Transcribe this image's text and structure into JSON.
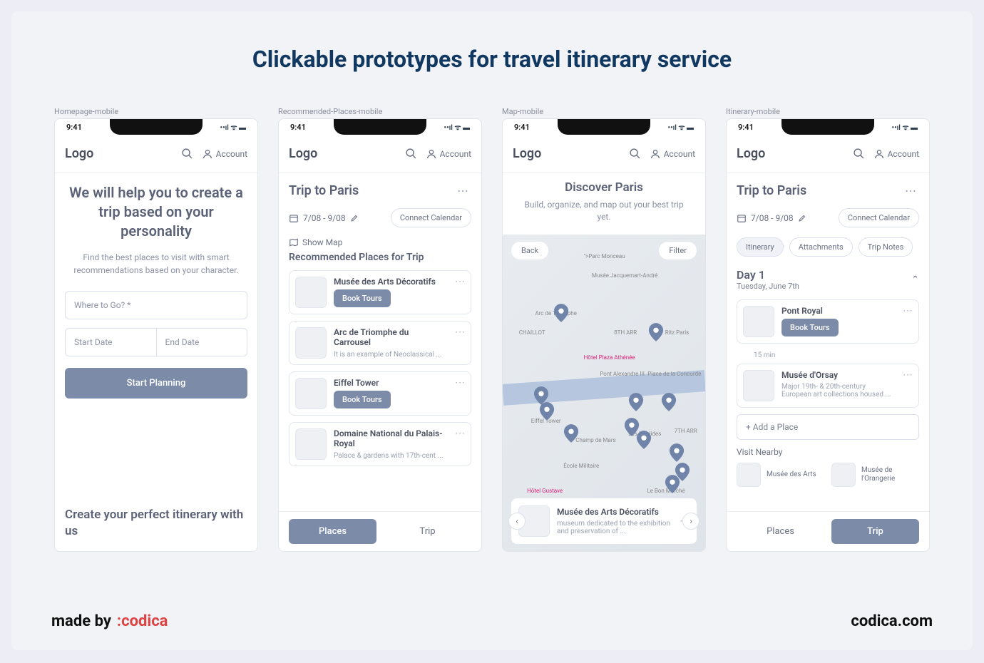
{
  "title": "Clickable prototypes for travel itinerary service",
  "status_time": "9:41",
  "logo": "Logo",
  "account_label": "Account",
  "screens": {
    "home": {
      "label": "Homepage-mobile",
      "hero_title": "We will help you to create a trip based on your personality",
      "hero_sub": "Find the best places to visit with smart recommendations based on your character.",
      "where_placeholder": "Where to Go? *",
      "start_date": "Start Date",
      "end_date": "End Date",
      "cta": "Start Planning",
      "bottom": "Create your perfect itinerary with us"
    },
    "places": {
      "label": "Recommended-Places-mobile",
      "trip_title": "Trip to Paris",
      "dates": "7/08 - 9/08",
      "connect": "Connect Calendar",
      "show_map": "Show Map",
      "section": "Recommended Places for Trip",
      "items": [
        {
          "name": "Musée des Arts Décoratifs",
          "action": "Book Tours"
        },
        {
          "name": "Arc de Triomphe du Carrousel",
          "desc": "It is an example of Neoclassical ..."
        },
        {
          "name": "Eiffel Tower",
          "action": "Book Tours"
        },
        {
          "name": "Domaine National du Palais-Royal",
          "desc": "Palace & gardens with 17th-cent ..."
        }
      ],
      "tab_places": "Places",
      "tab_trip": "Trip"
    },
    "map": {
      "label": "Map-mobile",
      "title": "Discover Paris",
      "sub": "Build, organize, and map out your best trip yet.",
      "back": "Back",
      "filter": "Filter",
      "card_title": "Musée des Arts Décoratifs",
      "card_desc": "museum dedicated to the exhibition and preservation of  ..."
    },
    "itinerary": {
      "label": "Itinerary-mobile",
      "trip_title": "Trip to Paris",
      "dates": "7/08 - 9/08",
      "connect": "Connect Calendar",
      "tabs": [
        "Itinerary",
        "Attachments",
        "Trip Notes"
      ],
      "day_title": "Day 1",
      "day_sub": "Tuesday, June 7th",
      "items": [
        {
          "name": "Pont Royal",
          "action": "Book Tours"
        },
        {
          "name": "Musée d'Orsay",
          "desc": "Major 19th- & 20th-century European art collections housed ..."
        }
      ],
      "gap": "15 min",
      "add_place": "+ Add a Place",
      "visit_nearby": "Visit Nearby",
      "nearby": [
        "Musée des Arts",
        "Musée de l'Orangerie"
      ],
      "tab_places": "Places",
      "tab_trip": "Trip"
    }
  },
  "credit": {
    "prefix": "made by",
    "brand": ":codica",
    "url": "codica.com"
  }
}
